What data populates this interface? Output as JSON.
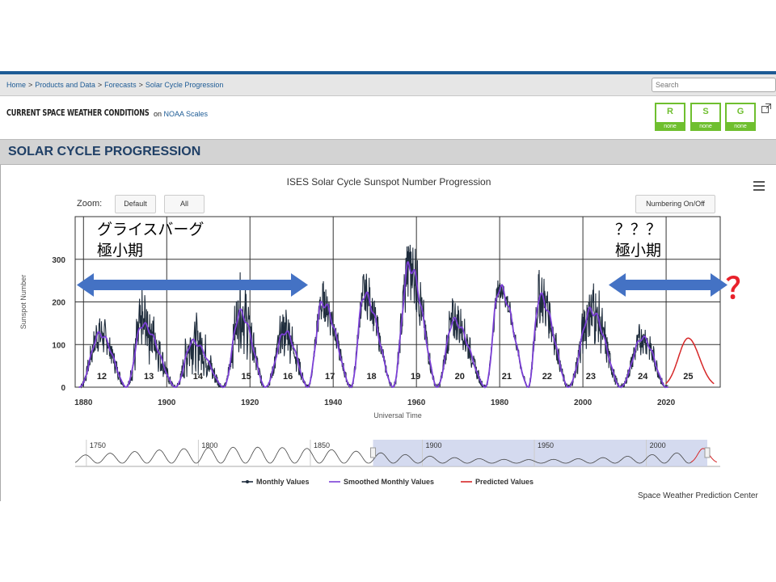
{
  "breadcrumb": [
    "Home",
    "Products and Data",
    "Forecasts",
    "Solar Cycle Progression"
  ],
  "search": {
    "placeholder": "Search"
  },
  "conditions": {
    "title": "CURRENT SPACE WEATHER CONDITIONS",
    "on_text": "on",
    "link": "NOAA Scales",
    "scales": [
      {
        "letter": "R",
        "status": "none"
      },
      {
        "letter": "S",
        "status": "none"
      },
      {
        "letter": "G",
        "status": "none"
      }
    ]
  },
  "section_title": "SOLAR CYCLE PROGRESSION",
  "zoom": {
    "label": "Zoom:",
    "default_label": "Default",
    "all_label": "All"
  },
  "numbering_button": "Numbering On/Off",
  "annotations": {
    "left_line1": "グライスバーグ",
    "left_line2": "極小期",
    "right_line1": "？？？",
    "right_line2": "極小期",
    "question_mark": "？"
  },
  "footer_credit": "Space Weather Prediction Center",
  "colors": {
    "monthly": "#1f2d3d",
    "smoothed": "#7b3fd6",
    "predicted": "#d62728",
    "arrow": "#4472c4",
    "navigator_fill": "#c6cdea"
  },
  "chart_data": {
    "type": "line",
    "title": "ISES Solar Cycle Sunspot Number Progression",
    "xlabel": "Universal Time",
    "ylabel": "Sunspot Number",
    "xlim": [
      1878,
      2033
    ],
    "ylim": [
      0,
      400
    ],
    "x_ticks": [
      "1880",
      "1900",
      "1920",
      "1940",
      "1960",
      "1980",
      "2000",
      "2020"
    ],
    "y_ticks": [
      "0",
      "100",
      "200",
      "300"
    ],
    "grid": true,
    "cycles": [
      {
        "label": "12",
        "min_year": 1878.9,
        "max_year": 1883.9,
        "peak_smoothed": 125,
        "peak_monthly": 160
      },
      {
        "label": "13",
        "min_year": 1890.2,
        "max_year": 1894.1,
        "peak_smoothed": 147,
        "peak_monthly": 215
      },
      {
        "label": "14",
        "min_year": 1902.0,
        "max_year": 1906.2,
        "peak_smoothed": 107,
        "peak_monthly": 165
      },
      {
        "label": "15",
        "min_year": 1913.6,
        "max_year": 1917.6,
        "peak_smoothed": 175,
        "peak_monthly": 250
      },
      {
        "label": "16",
        "min_year": 1923.6,
        "max_year": 1928.4,
        "peak_smoothed": 130,
        "peak_monthly": 180
      },
      {
        "label": "17",
        "min_year": 1933.8,
        "max_year": 1937.4,
        "peak_smoothed": 198,
        "peak_monthly": 240
      },
      {
        "label": "18",
        "min_year": 1944.2,
        "max_year": 1947.4,
        "peak_smoothed": 218,
        "peak_monthly": 260
      },
      {
        "label": "19",
        "min_year": 1954.3,
        "max_year": 1958.2,
        "peak_smoothed": 285,
        "peak_monthly": 360
      },
      {
        "label": "20",
        "min_year": 1964.9,
        "max_year": 1968.9,
        "peak_smoothed": 156,
        "peak_monthly": 200
      },
      {
        "label": "21",
        "min_year": 1976.5,
        "max_year": 1979.9,
        "peak_smoothed": 233,
        "peak_monthly": 255
      },
      {
        "label": "22",
        "min_year": 1986.8,
        "max_year": 1989.6,
        "peak_smoothed": 213,
        "peak_monthly": 265
      },
      {
        "label": "23",
        "min_year": 1996.4,
        "max_year": 2001.9,
        "peak_smoothed": 180,
        "peak_monthly": 245
      },
      {
        "label": "24",
        "min_year": 2008.9,
        "max_year": 2014.3,
        "peak_smoothed": 116,
        "peak_monthly": 145
      }
    ],
    "predicted": {
      "label": "25",
      "start_year": 2019.9,
      "peak_year": 2025.3,
      "peak_value": 115,
      "end_year": 2031.5
    },
    "legend": [
      "Monthly Values",
      "Smoothed Monthly Values",
      "Predicted Values"
    ],
    "legend_position": "bottom",
    "navigator": {
      "xlim": [
        1745,
        2033
      ],
      "x_ticks": [
        "1750",
        "1800",
        "1850",
        "1900",
        "1950",
        "2000"
      ],
      "selected_range": [
        1878,
        2033
      ]
    }
  }
}
